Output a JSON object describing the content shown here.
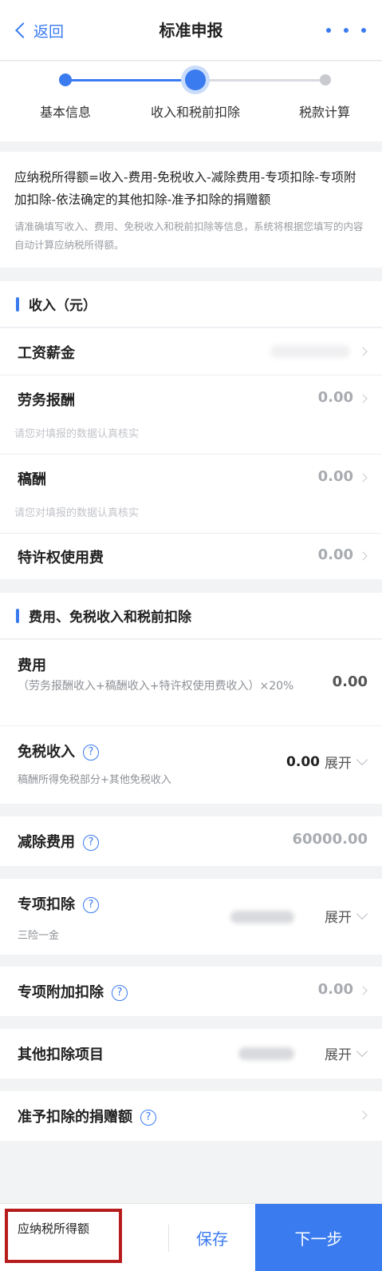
{
  "nav": {
    "back_label": "返回",
    "title": "标准申报"
  },
  "stepper": {
    "steps": [
      "基本信息",
      "收入和税前扣除",
      "税款计算"
    ]
  },
  "formula": {
    "main": "应纳税所得额=收入-费用-免税收入-减除费用-专项扣除-专项附加扣除-依法确定的其他扣除-准予扣除的捐赠额",
    "note": "请准确填写收入、费用、免税收入和税前扣除等信息，系统将根据您填写的内容自动计算应纳税所得额。"
  },
  "income": {
    "header": "收入（元）",
    "salary_label": "工资薪金",
    "labor_label": "劳务报酬",
    "labor_value": "0.00",
    "labor_hint": "请您对填报的数据认真核实",
    "royalty_label": "稿酬",
    "royalty_value": "0.00",
    "royalty_hint": "请您对填报的数据认真核实",
    "franchise_label": "特许权使用费",
    "franchise_value": "0.00"
  },
  "deductions": {
    "header": "费用、免税收入和税前扣除",
    "expense_label": "费用",
    "expense_formula": "（劳务报酬收入+稿酬收入+特许权使用费收入）×20%",
    "expense_value": "0.00",
    "taxfree_label": "免税收入",
    "taxfree_sub": "稿酬所得免税部分+其他免税收入",
    "taxfree_value": "0.00",
    "expand_label": "展开",
    "reduction_label": "减除费用",
    "reduction_value": "60000.00",
    "special_label": "专项扣除",
    "special_sub": "三险一金",
    "special_additional_label": "专项附加扣除",
    "special_additional_value": "0.00",
    "other_label": "其他扣除项目",
    "donation_label": "准予扣除的捐赠额",
    "help_glyph": "?"
  },
  "bottom": {
    "label": "应纳税所得额",
    "save": "保存",
    "next": "下一步"
  },
  "colors": {
    "accent": "#3a7bf0",
    "highlight_border": "#b71c1c"
  }
}
